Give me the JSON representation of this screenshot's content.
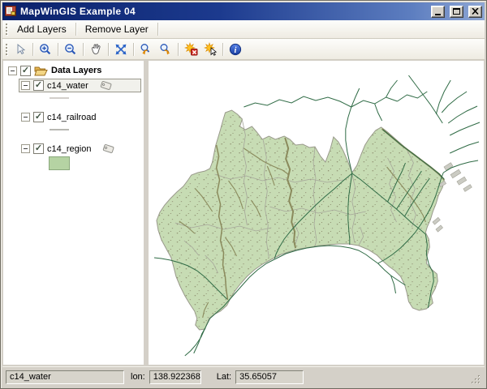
{
  "window": {
    "title": "MapWinGIS Example 04"
  },
  "menubar": {
    "add_layers": "Add Layers",
    "remove_layer": "Remove Layer"
  },
  "toolbar": {
    "icons": [
      "pointer",
      "zoom-in",
      "zoom-out",
      "pan-hand",
      "zoom-full-extent",
      "zoom-previous",
      "zoom-next",
      "clear-selection",
      "select-shapes",
      "info"
    ]
  },
  "layer_tree": {
    "root_label": "Data Layers",
    "layers": [
      {
        "label": "c14_water",
        "checked": true,
        "selected": true,
        "tagged": true,
        "symbol": "line",
        "symbol_color": "#b6b2aa"
      },
      {
        "label": "c14_railroad",
        "checked": true,
        "selected": false,
        "tagged": false,
        "symbol": "line",
        "symbol_color": "#8d8d85"
      },
      {
        "label": "c14_region",
        "checked": true,
        "selected": false,
        "tagged": true,
        "symbol": "fill",
        "symbol_color": "#b5d3a3",
        "symbol_border": "#8aa87c"
      }
    ]
  },
  "map": {
    "region_fill": "#c7dcb4",
    "region_stroke": "#99998b",
    "water_color": "#8a8a5c",
    "railroad_color": "#2f6b45",
    "boundary_color": "#a5a599",
    "urban_color": "#cbcbc3"
  },
  "status_bar": {
    "layer_name": "c14_water",
    "lon_label": "lon:",
    "lon_value": "138.922368",
    "lat_label": "Lat:",
    "lat_value": "35.65057"
  }
}
